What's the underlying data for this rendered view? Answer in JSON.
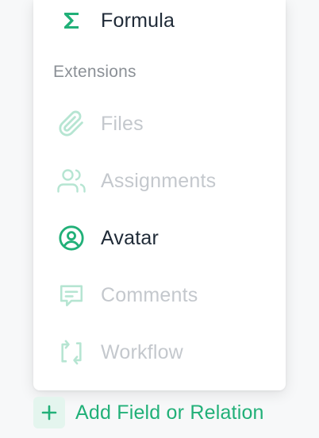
{
  "colors": {
    "accent": "#21b078",
    "accent_light": "#b6e5d2",
    "text_active": "#1f2a37",
    "text_disabled": "#c4c8cd",
    "section_title": "#8b9096"
  },
  "menu": {
    "formula": {
      "label": "Formula",
      "icon": "sigma-icon"
    },
    "extensions_title": "Extensions",
    "extensions": [
      {
        "label": "Files",
        "icon": "paperclip-icon",
        "enabled": false
      },
      {
        "label": "Assignments",
        "icon": "users-icon",
        "enabled": false
      },
      {
        "label": "Avatar",
        "icon": "user-circle-icon",
        "enabled": true
      },
      {
        "label": "Comments",
        "icon": "message-icon",
        "enabled": false
      },
      {
        "label": "Workflow",
        "icon": "repeat-icon",
        "enabled": false
      }
    ]
  },
  "add_field": {
    "label": "Add Field or Relation",
    "icon": "plus-icon"
  }
}
